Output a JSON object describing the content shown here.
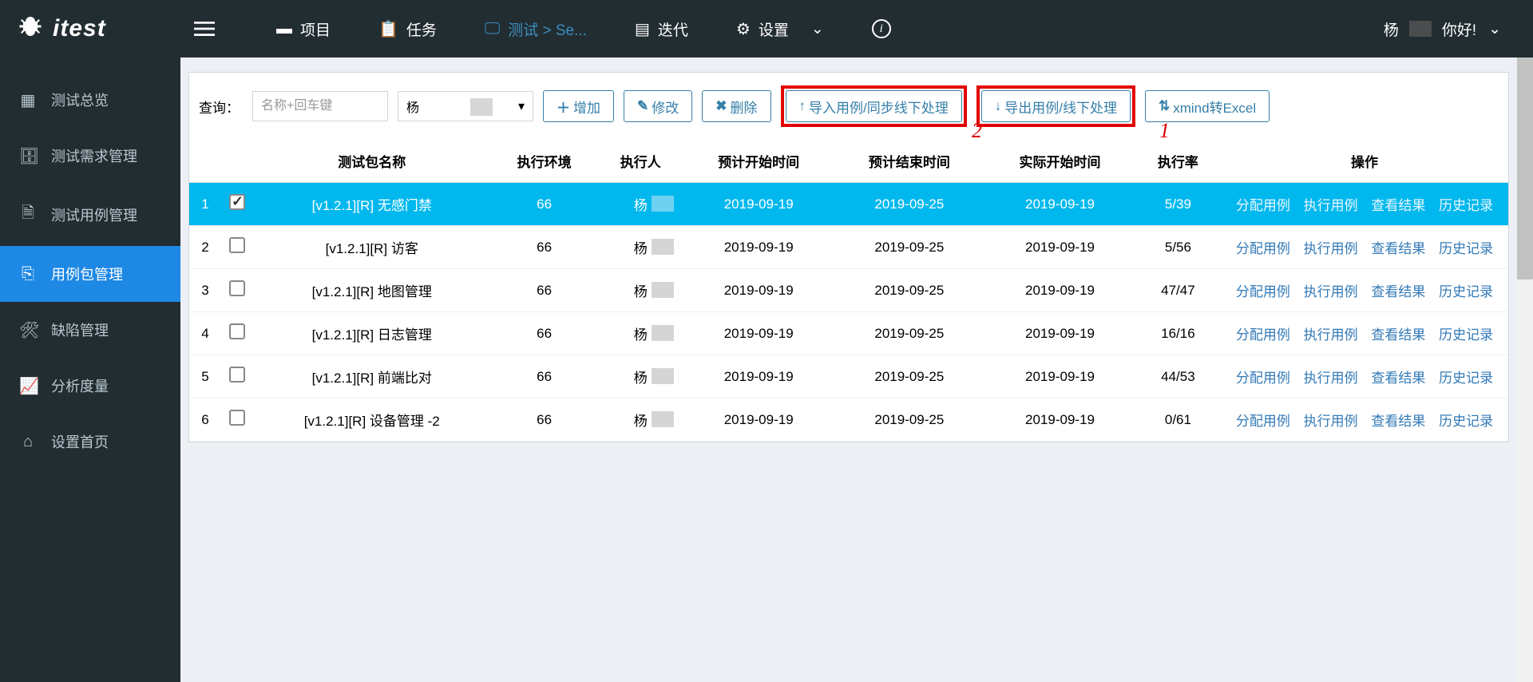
{
  "logo": {
    "text": "itest"
  },
  "topnav": {
    "project": "项目",
    "task": "任务",
    "test": "测试 > Se...",
    "iteration": "迭代",
    "settings": "设置"
  },
  "user": {
    "greeting_prefix": "杨",
    "greeting_suffix": " 你好!"
  },
  "sidebar": {
    "items": [
      {
        "label": "测试总览"
      },
      {
        "label": "测试需求管理"
      },
      {
        "label": "测试用例管理"
      },
      {
        "label": "用例包管理"
      },
      {
        "label": "缺陷管理"
      },
      {
        "label": "分析度量"
      },
      {
        "label": "设置首页"
      }
    ]
  },
  "toolbar": {
    "query_label": "查询：",
    "search_placeholder": "名称+回车键",
    "dropdown_value": "杨",
    "btn_add": "增加",
    "btn_edit": "修改",
    "btn_delete": "删除",
    "btn_import": "导入用例/同步线下处理",
    "btn_export": "导出用例/线下处理",
    "btn_xmind": "xmind转Excel"
  },
  "annotations": {
    "one": "1",
    "two": "2"
  },
  "table": {
    "headers": {
      "name": "测试包名称",
      "env": "执行环境",
      "executor": "执行人",
      "plan_start": "预计开始时间",
      "plan_end": "预计结束时间",
      "actual_start": "实际开始时间",
      "rate": "执行率",
      "ops": "操作"
    },
    "ops": {
      "assign": "分配用例",
      "execute": "执行用例",
      "result": "查看结果",
      "history": "历史记录"
    },
    "rows": [
      {
        "idx": "1",
        "checked": true,
        "selected": true,
        "name": "[v1.2.1][R] 无感门禁",
        "env": "66",
        "executor": "杨",
        "plan_start": "2019-09-19",
        "plan_end": "2019-09-25",
        "actual_start": "2019-09-19",
        "rate": "5/39"
      },
      {
        "idx": "2",
        "checked": false,
        "selected": false,
        "name": "[v1.2.1][R] 访客",
        "env": "66",
        "executor": "杨",
        "plan_start": "2019-09-19",
        "plan_end": "2019-09-25",
        "actual_start": "2019-09-19",
        "rate": "5/56"
      },
      {
        "idx": "3",
        "checked": false,
        "selected": false,
        "name": "[v1.2.1][R] 地图管理",
        "env": "66",
        "executor": "杨",
        "plan_start": "2019-09-19",
        "plan_end": "2019-09-25",
        "actual_start": "2019-09-19",
        "rate": "47/47"
      },
      {
        "idx": "4",
        "checked": false,
        "selected": false,
        "name": "[v1.2.1][R] 日志管理",
        "env": "66",
        "executor": "杨",
        "plan_start": "2019-09-19",
        "plan_end": "2019-09-25",
        "actual_start": "2019-09-19",
        "rate": "16/16"
      },
      {
        "idx": "5",
        "checked": false,
        "selected": false,
        "name": "[v1.2.1][R] 前端比对",
        "env": "66",
        "executor": "杨",
        "plan_start": "2019-09-19",
        "plan_end": "2019-09-25",
        "actual_start": "2019-09-19",
        "rate": "44/53"
      },
      {
        "idx": "6",
        "checked": false,
        "selected": false,
        "name": "[v1.2.1][R] 设备管理 -2",
        "env": "66",
        "executor": "杨",
        "plan_start": "2019-09-19",
        "plan_end": "2019-09-25",
        "actual_start": "2019-09-19",
        "rate": "0/61"
      }
    ]
  }
}
